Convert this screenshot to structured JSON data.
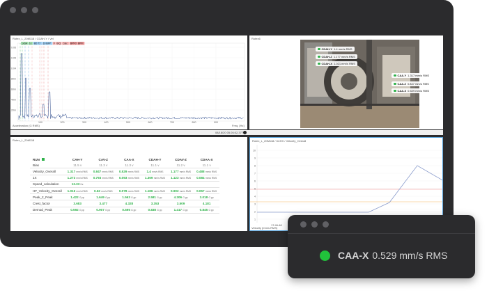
{
  "spectrum": {
    "title": "Rotex_L_20M118 / CDAH-Y / Vel",
    "y_axis_label": "Acceleration (G RMS)",
    "x_axis_label": "Freq. [Hz]",
    "x_ticks": [
      "100",
      "200",
      "300",
      "400",
      "500",
      "600",
      "700",
      "800",
      "900"
    ],
    "y_ticks": [
      "0.06",
      "0.05",
      "0.04",
      "80m",
      "60m",
      "40m",
      "20m"
    ],
    "markers": [
      "1xSH",
      "1x",
      "BD 77",
      "10 BFP",
      "F",
      "B/Q",
      "Calc",
      "BPFO",
      "BPFI"
    ],
    "status_text": "08/18/20 05:26:02,377"
  },
  "photo": {
    "title": "Rotex6",
    "tags": [
      {
        "name": "CDAH-Y",
        "value": "1.4 mm/s RMS"
      },
      {
        "name": "CDAH-Z",
        "value": "1.177 mm/s RMS"
      },
      {
        "name": "CDAH-X",
        "value": "1.021 mm/s RMS"
      },
      {
        "name": "CAA-Y",
        "value": "1.317 mm/s RMS"
      },
      {
        "name": "CAA-Z",
        "value": "0.847 mm/s RMS"
      },
      {
        "name": "CAA-X",
        "value": "0.529 mm/s RMS"
      }
    ]
  },
  "table": {
    "title": "Rotex_L_20M118",
    "header_label": "RUN",
    "columns": [
      "CAH-Y",
      "CAV-Z",
      "CAA-X",
      "CDAH-Y",
      "CDAV-Z",
      "CDAA-X"
    ],
    "rows": [
      {
        "label": "Bias",
        "kind": "gray",
        "cells": [
          {
            "v": "11.5",
            "u": "V"
          },
          {
            "v": "11.3",
            "u": "V"
          },
          {
            "v": "11.3",
            "u": "V"
          },
          {
            "v": "11.1",
            "u": "V"
          },
          {
            "v": "11.2",
            "u": "V"
          },
          {
            "v": "11.1",
            "u": "V"
          }
        ]
      },
      {
        "label": "Velocity_Overall",
        "kind": "green",
        "cells": [
          {
            "v": "1.317",
            "u": "mm/s RMS"
          },
          {
            "v": "0.847",
            "u": "mm/s RMS"
          },
          {
            "v": "0.529",
            "u": "mm/s RMS"
          },
          {
            "v": "1.4",
            "u": "mm/s RMS"
          },
          {
            "v": "1.177",
            "u": "mm/s RMS"
          },
          {
            "v": "0.488",
            "u": "mm/s RMS"
          }
        ]
      },
      {
        "label": "1X",
        "kind": "green",
        "cells": [
          {
            "v": "1.273",
            "u": "mm/s RMS"
          },
          {
            "v": "0.793",
            "u": "mm/s RMS"
          },
          {
            "v": "0.093",
            "u": "mm/s RMS"
          },
          {
            "v": "1.369",
            "u": "mm/s RMS"
          },
          {
            "v": "1.123",
            "u": "mm/s RMS"
          },
          {
            "v": "0.084",
            "u": "mm/s RMS"
          }
        ]
      },
      {
        "label": "Speed_calculation",
        "kind": "green",
        "cells": [
          {
            "v": "12.33",
            "u": "Hz"
          },
          {
            "v": "",
            "u": ""
          },
          {
            "v": "",
            "u": ""
          },
          {
            "v": "",
            "u": ""
          },
          {
            "v": "",
            "u": ""
          },
          {
            "v": "",
            "u": ""
          }
        ]
      },
      {
        "label": "HF_Velocity_Overall",
        "kind": "green",
        "cells": [
          {
            "v": "1.016",
            "u": "mm/s RMS"
          },
          {
            "v": "0.62",
            "u": "mm/s RMS"
          },
          {
            "v": "0.078",
            "u": "mm/s RMS"
          },
          {
            "v": "1.186",
            "u": "mm/s RMS"
          },
          {
            "v": "0.902",
            "u": "mm/s RMS"
          },
          {
            "v": "0.057",
            "u": "mm/s RMS"
          }
        ]
      },
      {
        "label": "Peak_2_Peak",
        "kind": "green",
        "cells": [
          {
            "v": "1.422",
            "u": "G pp"
          },
          {
            "v": "1.649",
            "u": "G pp"
          },
          {
            "v": "1.563",
            "u": "G pp"
          },
          {
            "v": "2.581",
            "u": "G pp"
          },
          {
            "v": "4.306",
            "u": "G pp"
          },
          {
            "v": "3.018",
            "u": "G pp"
          }
        ]
      },
      {
        "label": "Crest_factor",
        "kind": "green",
        "cells": [
          {
            "v": "3.683",
            "u": ""
          },
          {
            "v": "3.477",
            "u": ""
          },
          {
            "v": "4.328",
            "u": ""
          },
          {
            "v": "3.353",
            "u": ""
          },
          {
            "v": "3.509",
            "u": ""
          },
          {
            "v": "4.181",
            "u": ""
          }
        ]
      },
      {
        "label": "Demod_Peak",
        "kind": "green",
        "cells": [
          {
            "v": "0.592",
            "u": "G pp"
          },
          {
            "v": "0.907",
            "u": "G pp"
          },
          {
            "v": "0.595",
            "u": "G pp"
          },
          {
            "v": "0.838",
            "u": "G pp"
          },
          {
            "v": "1.417",
            "u": "G pp"
          },
          {
            "v": "0.845",
            "u": "G pp"
          }
        ]
      }
    ]
  },
  "trend": {
    "title": "Rotex_L_20M118 / DeHX / Velocity_Overall",
    "y_axis_label": "Velocity (mm/s RMS)",
    "x_label": "17:46:48",
    "y_ticks": [
      "10",
      "9",
      "8",
      "7",
      "6",
      "5",
      "4",
      "3",
      "2",
      "1"
    ]
  },
  "popup": {
    "name": "CAA-X",
    "value": "0.529 mm/s RMS",
    "status_color": "#21c13b"
  },
  "colors": {
    "window_bg": "#2b2b2d",
    "ok_green": "#2fb24a",
    "spectrum_blue": "#2c4a8c",
    "trend_line": "#8a9ccc"
  }
}
